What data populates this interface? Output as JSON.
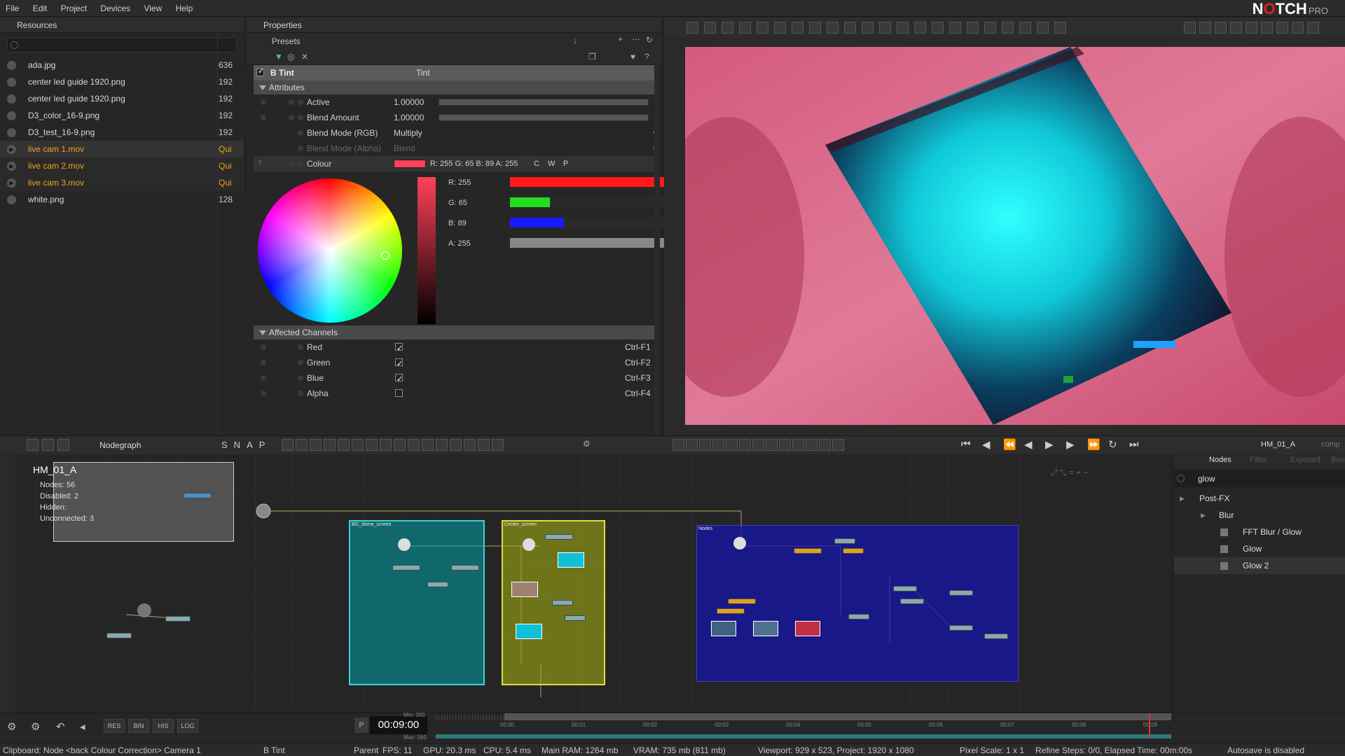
{
  "menu": [
    "File",
    "Edit",
    "Project",
    "Devices",
    "View",
    "Help"
  ],
  "logo": {
    "brand_a": "N",
    "brand_o": "O",
    "brand_b": "TCH",
    "suffix": "PRO"
  },
  "resources": {
    "title": "Resources",
    "items": [
      {
        "name": "ada.jpg",
        "num": "636",
        "live": false
      },
      {
        "name": "center led guide 1920.png",
        "num": "192",
        "live": false
      },
      {
        "name": "center led guide 1920.png",
        "num": "192",
        "live": false
      },
      {
        "name": "D3_color_16-9.png",
        "num": "192",
        "live": false
      },
      {
        "name": "D3_test_16-9.png",
        "num": "192",
        "live": false
      },
      {
        "name": "live cam 1.mov",
        "num": "Qui",
        "live": true
      },
      {
        "name": "live cam 2.mov",
        "num": "Qui",
        "live": true
      },
      {
        "name": "live cam 3.mov",
        "num": "Qui",
        "live": true
      },
      {
        "name": "white.png",
        "num": "128",
        "live": false
      }
    ]
  },
  "properties": {
    "title": "Properties",
    "presets_label": "Presets",
    "node_name": "B Tint",
    "node_type": "Tint",
    "attributes_label": "Attributes",
    "rows": [
      {
        "label": "Active",
        "value": "1.00000"
      },
      {
        "label": "Blend Amount",
        "value": "1.00000"
      },
      {
        "label": "Blend Mode (RGB)",
        "value": "Multiply"
      },
      {
        "label": "Blend Mode (Alpha)",
        "value": "Blend"
      }
    ],
    "colour_label": "Colour",
    "colour_value": "R: 255 G: 65 B: 89 A: 255",
    "colour_flags": [
      "C",
      "W",
      "P"
    ],
    "channels": [
      {
        "label": "R: 255",
        "value": 255,
        "color": "#ff1a1a"
      },
      {
        "label": "G: 65",
        "value": 65,
        "color": "#22dd22"
      },
      {
        "label": "B: 89",
        "value": 89,
        "color": "#1a1aff"
      },
      {
        "label": "A: 255",
        "value": 255,
        "color": "#888888"
      }
    ],
    "affected_label": "Affected Channels",
    "affected": [
      {
        "label": "Red",
        "checked": true,
        "shortcut": "Ctrl-F1"
      },
      {
        "label": "Green",
        "checked": true,
        "shortcut": "Ctrl-F2"
      },
      {
        "label": "Blue",
        "checked": true,
        "shortcut": "Ctrl-F3"
      },
      {
        "label": "Alpha",
        "checked": false,
        "shortcut": "Ctrl-F4"
      }
    ]
  },
  "nodegraph": {
    "title": "Nodegraph",
    "letters": [
      "S",
      "N",
      "A",
      "P"
    ],
    "layer_name": "HM_01_A",
    "stats": {
      "nodes": "Nodes:  56",
      "disabled": "Disabled:  2",
      "hidden": "Hidden:",
      "unconnected": "Unconnected:  3"
    },
    "groups": [
      "BG_dome_screen",
      "Center_screen",
      "Nodes"
    ]
  },
  "right_panel": {
    "layer": "HM_01_A",
    "comp": "comp",
    "tabs": [
      "Nodes",
      "Filter",
      "Exposed",
      "Bound"
    ],
    "search": "glow",
    "tree": [
      {
        "label": "Post-FX",
        "level": 0
      },
      {
        "label": "Blur",
        "level": 1
      },
      {
        "label": "FFT Blur / Glow",
        "level": 2
      },
      {
        "label": "Glow",
        "level": 2
      },
      {
        "label": "Glow 2",
        "level": 2
      }
    ]
  },
  "timeline": {
    "time": "00:09:00",
    "min": "Min: 000",
    "max": "Max: 060",
    "ticks": [
      "00:00",
      "00:01",
      "00:02",
      "00:03",
      "00:04",
      "00:05",
      "00:06",
      "00:07",
      "00:08",
      "00:09"
    ],
    "buttons": [
      "RES",
      "BIN",
      "HIS",
      "LOG"
    ]
  },
  "status": {
    "clipboard": "Clipboard: Node <back Colour Correction> Camera 1",
    "node": "B Tint",
    "parent": "Parent",
    "fps": "FPS: 11",
    "gpu": "GPU: 20.3 ms",
    "cpu": "CPU: 5.4 ms",
    "ram": "Main RAM: 1264 mb",
    "vram": "VRAM: 735 mb (811 mb)",
    "viewport": "Viewport: 929 x 523, Project: 1920 x 1080",
    "pixel": "Pixel Scale: 1 x 1",
    "refine": "Refine Steps: 0/0, Elapsed Time: 00m:00s",
    "autosave": "Autosave is disabled"
  },
  "colors": {
    "accent": "#f0a020",
    "sel_colour": "#ff4159"
  }
}
